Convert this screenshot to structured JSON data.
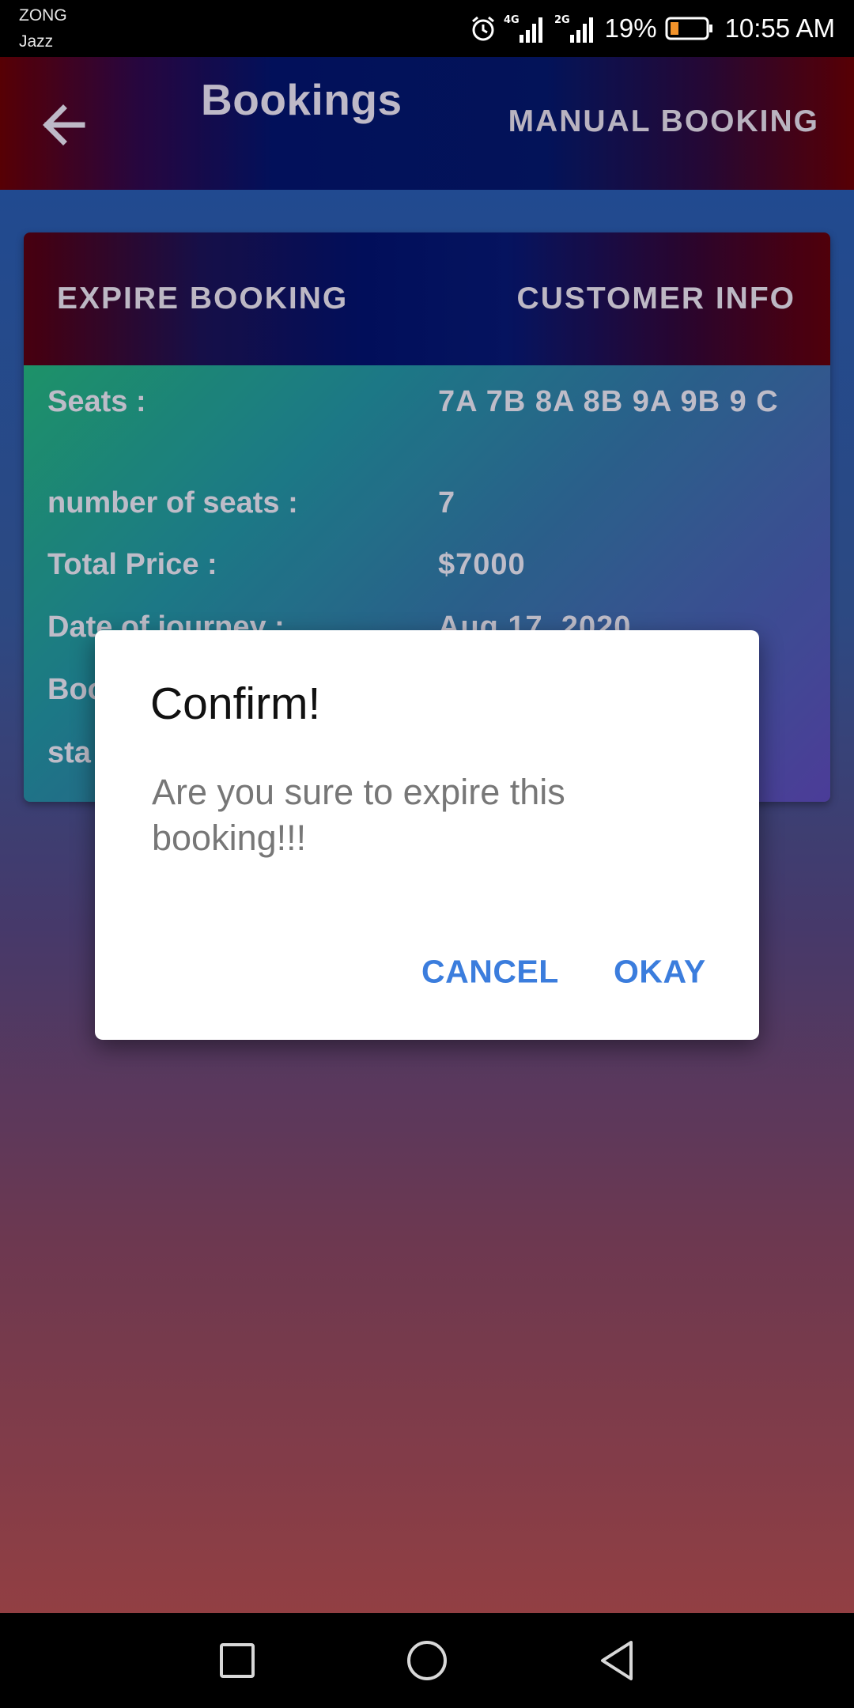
{
  "status_bar": {
    "carrier_primary": "ZONG",
    "carrier_secondary": "Jazz",
    "network_1": "4G",
    "network_2": "2G",
    "battery_percent": "19%",
    "time": "10:55 AM",
    "icons": [
      "alarm-icon",
      "signal-4g-icon",
      "signal-2g-icon",
      "battery-icon"
    ]
  },
  "app_bar": {
    "title": "Bookings",
    "action_label": "MANUAL BOOKING",
    "back_icon": "arrow-left-icon"
  },
  "card": {
    "actions": {
      "expire": "EXPIRE BOOKING",
      "customer_info": "CUSTOMER INFO"
    },
    "rows": [
      {
        "label": "Seats :",
        "value": "7A 7B 8A 8B 9A 9B 9 C"
      },
      {
        "label": "number of seats :",
        "value": "7"
      },
      {
        "label": "Total Price :",
        "value": "$7000"
      },
      {
        "label": "Date of journey :",
        "value": "Aug 17, 2020"
      },
      {
        "label": "Boo",
        "value": ""
      },
      {
        "label": "sta",
        "value": ""
      }
    ]
  },
  "dialog": {
    "title": "Confirm!",
    "message": "Are you sure to expire this booking!!!",
    "cancel_label": "CANCEL",
    "ok_label": "OKAY"
  },
  "nav_bar": {
    "icons": [
      "recents-square-icon",
      "home-circle-icon",
      "back-triangle-icon"
    ]
  },
  "colors": {
    "dialog_button": "#3b7ddd",
    "app_bar_center": "#04155e",
    "app_bar_edge": "#5c0005"
  }
}
